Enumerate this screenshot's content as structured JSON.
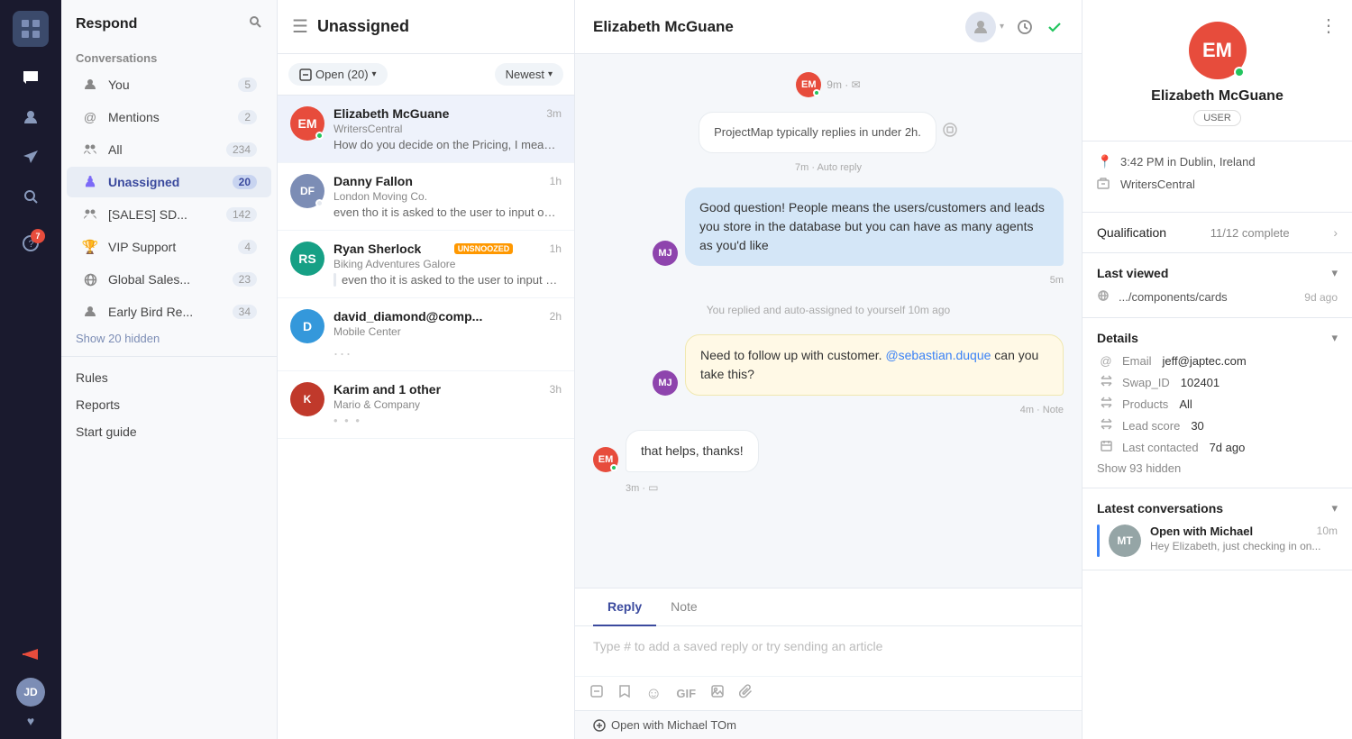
{
  "app": {
    "title": "Respond"
  },
  "left_nav": {
    "icons": [
      {
        "name": "grid-icon",
        "symbol": "⊞",
        "badge": null
      },
      {
        "name": "users-icon",
        "symbol": "👤",
        "badge": null
      },
      {
        "name": "rocket-icon",
        "symbol": "🚀",
        "badge": null
      },
      {
        "name": "search-icon",
        "symbol": "🔍",
        "badge": null
      },
      {
        "name": "help-icon",
        "symbol": "❓",
        "badge": "7"
      }
    ]
  },
  "sidebar": {
    "title": "Respond",
    "sections": {
      "conversations_label": "Conversations",
      "items": [
        {
          "id": "you",
          "label": "You",
          "icon": "👤",
          "count": 5
        },
        {
          "id": "mentions",
          "label": "Mentions",
          "icon": "@",
          "count": 2
        },
        {
          "id": "all",
          "label": "All",
          "icon": "👥",
          "count": 234
        },
        {
          "id": "unassigned",
          "label": "Unassigned",
          "icon": "♟",
          "count": 20,
          "active": true
        },
        {
          "id": "sales",
          "label": "[SALES] SD...",
          "icon": "👥",
          "count": 142
        },
        {
          "id": "vip",
          "label": "VIP Support",
          "icon": "🏆",
          "count": 4
        },
        {
          "id": "global",
          "label": "Global Sales...",
          "icon": "🌐",
          "count": 23
        },
        {
          "id": "early",
          "label": "Early Bird Re...",
          "icon": "👤",
          "count": 34
        }
      ],
      "show_hidden": "Show 20 hidden"
    },
    "links": [
      {
        "id": "rules",
        "label": "Rules"
      },
      {
        "id": "reports",
        "label": "Reports"
      },
      {
        "id": "start_guide",
        "label": "Start guide"
      }
    ]
  },
  "conv_panel": {
    "title": "Unassigned",
    "filter": {
      "open_label": "Open (20)",
      "sort_label": "Newest"
    },
    "conversations": [
      {
        "id": "1",
        "name": "Elizabeth McGuane",
        "company": "WritersCentral",
        "time": "3m",
        "preview": "How do you decide on the Pricing, I mean what is your definition of People? When...",
        "avatar_color": "#e74c3c",
        "avatar_initials": "EM",
        "online": true,
        "active": true
      },
      {
        "id": "2",
        "name": "Danny Fallon",
        "company": "London Moving Co.",
        "time": "1h",
        "preview": "even tho it is asked to the user to input on one line, can we show more lines of text...",
        "avatar_color": null,
        "avatar_img": true,
        "online": false,
        "active": false
      },
      {
        "id": "3",
        "name": "Ryan Sherlock",
        "company": "Biking Adventures Galore",
        "time": "1h",
        "preview": "even tho it is asked to the user to input on one line, can we show...",
        "avatar_color": "#16a085",
        "avatar_initials": "RS",
        "badge": "UNSNOOZED",
        "online": false,
        "active": false
      },
      {
        "id": "4",
        "name": "david_diamond@comp...",
        "company": "Mobile Center",
        "time": "2h",
        "preview": "...",
        "avatar_color": "#3498db",
        "avatar_initials": "D",
        "online": false,
        "active": false
      },
      {
        "id": "5",
        "name": "Karim and 1 other",
        "company": "Mario & Company",
        "time": "3h",
        "preview": "...",
        "avatar_color": null,
        "avatar_img": true,
        "online": false,
        "active": false
      }
    ]
  },
  "chat": {
    "contact_name": "Elizabeth McGuane",
    "messages": [
      {
        "id": "m1",
        "type": "incoming",
        "meta": "9m · ✉",
        "show_meta": true
      },
      {
        "id": "m2",
        "type": "system",
        "text": "ProjectMap typically replies in under 2h.",
        "sub_meta": "7m · Auto reply"
      },
      {
        "id": "m3",
        "type": "outgoing",
        "text": "Good question! People means the users/customers and leads you store in the database but you can have as many agents as you'd like",
        "time": "5m",
        "avatar_color": "#8e44ad",
        "avatar_initials": "MJ"
      },
      {
        "id": "m4",
        "type": "system_info",
        "text": "You replied and auto-assigned to yourself 10m ago"
      },
      {
        "id": "m5",
        "type": "note",
        "text_before": "Need to follow up with customer. ",
        "mention": "@sebastian.duque",
        "text_after": " can you take this?",
        "time": "4m",
        "meta": "Note",
        "avatar_color": "#8e44ad",
        "avatar_initials": "MJ"
      },
      {
        "id": "m6",
        "type": "incoming",
        "text": "that helps, thanks!",
        "time": "3m",
        "avatar_color": "#e74c3c",
        "avatar_initials": "EM",
        "online": true,
        "icon": "□"
      }
    ],
    "reply": {
      "tabs": [
        "Reply",
        "Note"
      ],
      "active_tab": "Reply",
      "placeholder": "Type # to add a saved reply or try sending an article"
    },
    "open_with": {
      "label": "Open with Michael TOm"
    }
  },
  "right_panel": {
    "contact": {
      "initials": "EM",
      "name": "Elizabeth McGuane",
      "role": "USER",
      "avatar_color": "#e74c3c",
      "online": true,
      "time_location": "3:42 PM in Dublin, Ireland",
      "company": "WritersCentral"
    },
    "qualification": {
      "label": "Qualification",
      "value": "11/12 complete"
    },
    "last_viewed": {
      "label": "Last viewed",
      "url": ".../components/cards",
      "time": "9d ago"
    },
    "details": {
      "label": "Details",
      "items": [
        {
          "icon": "@",
          "label": "Email",
          "value": "jeff@japtec.com"
        },
        {
          "icon": "⇄",
          "label": "Swap_ID",
          "value": "102401"
        },
        {
          "icon": "⇄",
          "label": "Products",
          "value": "All"
        },
        {
          "icon": "⇄",
          "label": "Lead score",
          "value": "30"
        },
        {
          "icon": "📅",
          "label": "Last contacted",
          "value": "7d ago"
        }
      ],
      "show_hidden": "Show 93 hidden"
    },
    "latest_conversations": {
      "label": "Latest conversations",
      "items": [
        {
          "label": "Open with Michael",
          "time": "10m",
          "preview": "Hey Elizabeth, just checking in on..."
        }
      ]
    }
  }
}
